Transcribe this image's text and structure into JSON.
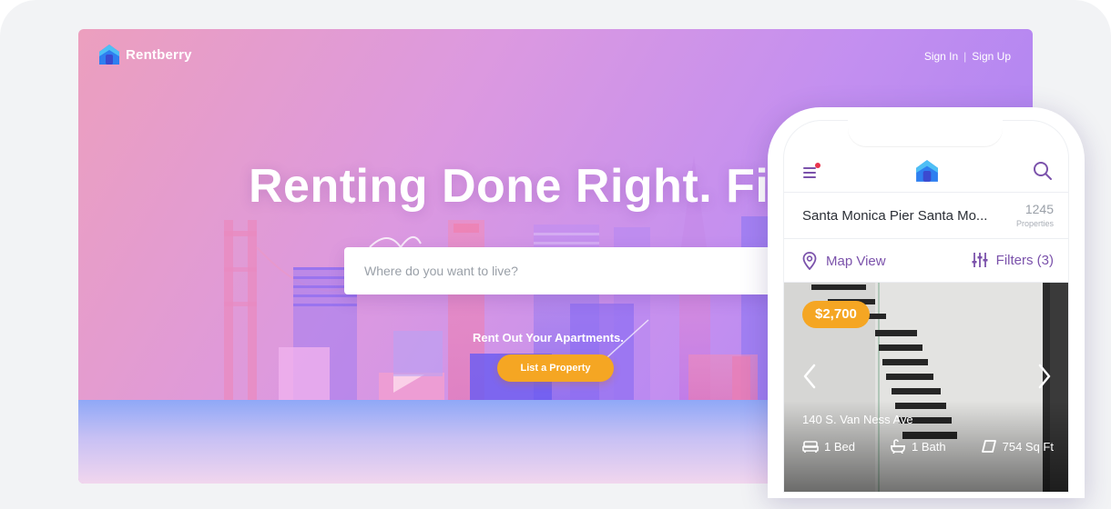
{
  "brand": {
    "name": "Rentberry"
  },
  "auth": {
    "sign_in": "Sign In",
    "separator": "|",
    "sign_up": "Sign Up"
  },
  "hero": {
    "headline": "Renting Done Right. Fin",
    "search_placeholder": "Where do you want to live?",
    "rent_title": "Rent Out Your Apartments.",
    "list_button": "List a Property"
  },
  "colors": {
    "accent_orange": "#f5a623",
    "purple": "#7b52ab",
    "notification_dot": "#e8344e"
  },
  "phone": {
    "location": {
      "name": "Santa Monica Pier Santa Mo...",
      "count": "1245",
      "count_label": "Properties"
    },
    "tools": {
      "map_view": "Map View",
      "filters": "Filters (3)"
    },
    "listing": {
      "price": "$2,700",
      "address": "140 S. Van Ness Ave",
      "beds": "1 Bed",
      "baths": "1 Bath",
      "area": "754 Sq Ft"
    },
    "icons": [
      "menu-icon",
      "home-logo-icon",
      "search-icon",
      "map-pin-icon",
      "sliders-icon",
      "chevron-left-icon",
      "chevron-right-icon",
      "bed-icon",
      "bath-icon",
      "area-icon"
    ]
  }
}
